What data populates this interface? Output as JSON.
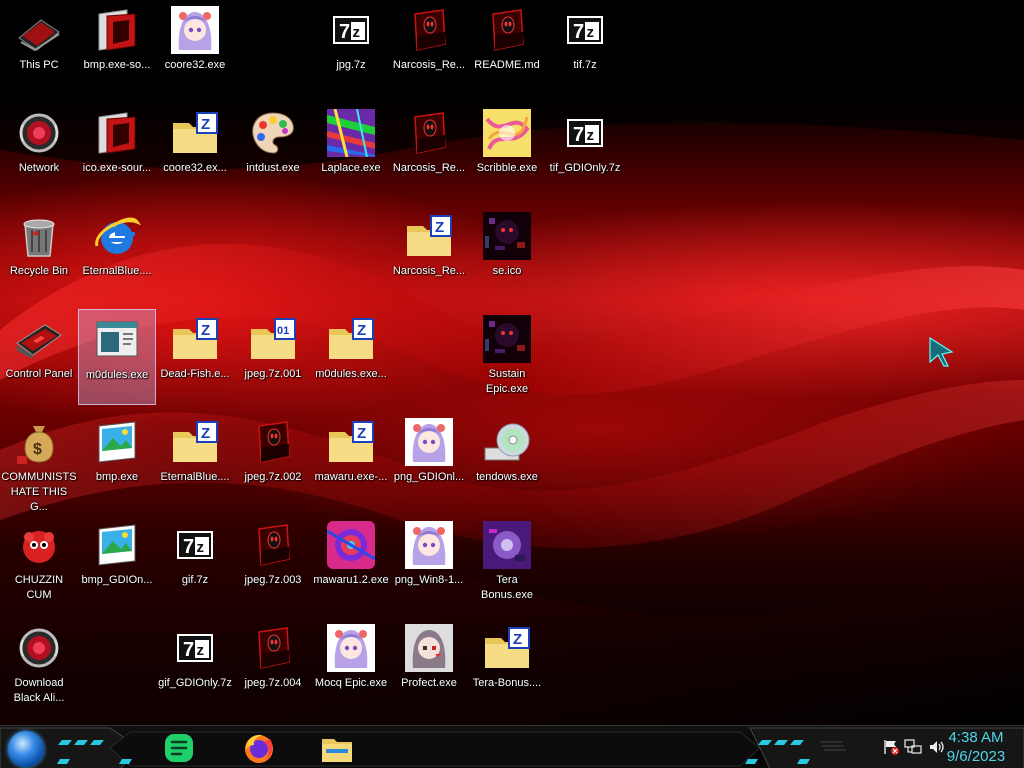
{
  "desktop": {
    "icons": [
      {
        "label": "This PC",
        "icon": "this-pc-icon",
        "name": "desktop-icon-this-pc"
      },
      {
        "label": "bmp.exe-so...",
        "icon": "red-exe-icon",
        "name": "desktop-icon-bmp-exe-source"
      },
      {
        "label": "coore32.exe",
        "icon": "anime-girl-icon",
        "name": "desktop-icon-coore32-exe"
      },
      {
        "label": "jpg.7z",
        "icon": "7z-archive-icon",
        "name": "desktop-icon-jpg-7z"
      },
      {
        "label": "Narcosis_Re...",
        "icon": "alien-exe-icon",
        "name": "desktop-icon-narcosis-1"
      },
      {
        "label": "README.md",
        "icon": "alien-exe-icon",
        "name": "desktop-icon-readme-md"
      },
      {
        "label": "tif.7z",
        "icon": "7z-archive-icon",
        "name": "desktop-icon-tif-7z"
      },
      {
        "label": "Network",
        "icon": "network-icon",
        "name": "desktop-icon-network"
      },
      {
        "label": "ico.exe-sour...",
        "icon": "red-exe-icon",
        "name": "desktop-icon-ico-exe-source"
      },
      {
        "label": "coore32.ex...",
        "icon": "zipped-folder-icon",
        "name": "desktop-icon-coore32-zip"
      },
      {
        "label": "intdust.exe",
        "icon": "paint-palette-icon",
        "name": "desktop-icon-intdust-exe"
      },
      {
        "label": "Laplace.exe",
        "icon": "glitch-noise-icon",
        "name": "desktop-icon-laplace-exe"
      },
      {
        "label": "Narcosis_Re...",
        "icon": "alien-exe-icon",
        "name": "desktop-icon-narcosis-2"
      },
      {
        "label": "Scribble.exe",
        "icon": "scribble-icon",
        "name": "desktop-icon-scribble-exe"
      },
      {
        "label": "tif_GDIOnly.7z",
        "icon": "7z-archive-icon",
        "name": "desktop-icon-tif-gdionly-7z"
      },
      {
        "label": "Recycle Bin",
        "icon": "recycle-bin-icon",
        "name": "desktop-icon-recycle-bin"
      },
      {
        "label": "EternalBlue....",
        "icon": "internet-explorer-icon",
        "name": "desktop-icon-eternalblue-ie"
      },
      {
        "label": "Narcosis_Re...",
        "icon": "zipped-folder-icon",
        "name": "desktop-icon-narcosis-zip"
      },
      {
        "label": "se.ico",
        "icon": "dark-glitch-icon",
        "name": "desktop-icon-se-ico"
      },
      {
        "label": "Control Panel",
        "icon": "control-panel-icon",
        "name": "desktop-icon-control-panel"
      },
      {
        "label": "m0dules.exe",
        "icon": "window-app-icon",
        "name": "desktop-icon-m0dules-exe"
      },
      {
        "label": "Dead-Fish.e...",
        "icon": "zipped-folder-icon",
        "name": "desktop-icon-dead-fish"
      },
      {
        "label": "jpeg.7z.001",
        "icon": "split-folder-icon",
        "name": "desktop-icon-jpeg-7z-001"
      },
      {
        "label": "m0dules.exe...",
        "icon": "zipped-folder-icon",
        "name": "desktop-icon-m0dules-zip"
      },
      {
        "label": "Sustain Epic.exe",
        "icon": "dark-glitch-icon",
        "name": "desktop-icon-sustain-epic"
      },
      {
        "label": "COMMUNISTS HATE THIS G...",
        "icon": "money-bag-icon",
        "name": "desktop-icon-communists"
      },
      {
        "label": "bmp.exe",
        "icon": "image-file-icon",
        "name": "desktop-icon-bmp-exe"
      },
      {
        "label": "EternalBlue....",
        "icon": "zipped-folder-icon",
        "name": "desktop-icon-eternalblue-zip"
      },
      {
        "label": "jpeg.7z.002",
        "icon": "alien-exe-icon",
        "name": "desktop-icon-jpeg-7z-002"
      },
      {
        "label": "mawaru.exe-...",
        "icon": "zipped-folder-icon",
        "name": "desktop-icon-mawaru-zip"
      },
      {
        "label": "png_GDIOnl...",
        "icon": "anime-girl-icon",
        "name": "desktop-icon-png-gdionly"
      },
      {
        "label": "tendows.exe",
        "icon": "cd-drive-icon",
        "name": "desktop-icon-tendows-exe"
      },
      {
        "label": "CHUZZIN CUM",
        "icon": "red-chuzzle-icon",
        "name": "desktop-icon-chuzzin"
      },
      {
        "label": "bmp_GDIOn...",
        "icon": "image-file-icon",
        "name": "desktop-icon-bmp-gdionly"
      },
      {
        "label": "gif.7z",
        "icon": "7z-archive-icon",
        "name": "desktop-icon-gif-7z"
      },
      {
        "label": "jpeg.7z.003",
        "icon": "alien-exe-icon",
        "name": "desktop-icon-jpeg-7z-003"
      },
      {
        "label": "mawaru1.2.exe",
        "icon": "psychedelic-icon",
        "name": "desktop-icon-mawaru12"
      },
      {
        "label": "png_Win8-1...",
        "icon": "anime-girl-icon",
        "name": "desktop-icon-png-win8"
      },
      {
        "label": "Tera Bonus.exe",
        "icon": "purple-glitch-icon",
        "name": "desktop-icon-tera-bonus-exe"
      },
      {
        "label": "Download Black Ali...",
        "icon": "network-icon",
        "name": "desktop-icon-download-black"
      },
      {
        "label": "gif_GDIOnly.7z",
        "icon": "7z-archive-icon",
        "name": "desktop-icon-gif-gdionly-7z"
      },
      {
        "label": "jpeg.7z.004",
        "icon": "alien-exe-icon",
        "name": "desktop-icon-jpeg-7z-004"
      },
      {
        "label": "Mocq Epic.exe",
        "icon": "anime-girl-icon",
        "name": "desktop-icon-mocq-epic"
      },
      {
        "label": "Profect.exe",
        "icon": "pixel-girl-icon",
        "name": "desktop-icon-profect"
      },
      {
        "label": "Tera-Bonus....",
        "icon": "zipped-folder-icon",
        "name": "desktop-icon-tera-bonus-zip"
      }
    ],
    "selected_icon": "m0dules.exe"
  },
  "taskbar": {
    "pinned": [
      {
        "icon": "notes-app-icon",
        "name": "taskbar-notes"
      },
      {
        "icon": "firefox-icon",
        "name": "taskbar-firefox"
      },
      {
        "icon": "file-explorer-icon",
        "name": "taskbar-file-explorer"
      }
    ],
    "clock_time": "4:38 AM",
    "clock_date": "9/6/2023"
  },
  "colors": {
    "clock": "#4fd6e8",
    "accent_cyan": "#29c8e0",
    "wallpaper_red": "#c00a0a"
  }
}
